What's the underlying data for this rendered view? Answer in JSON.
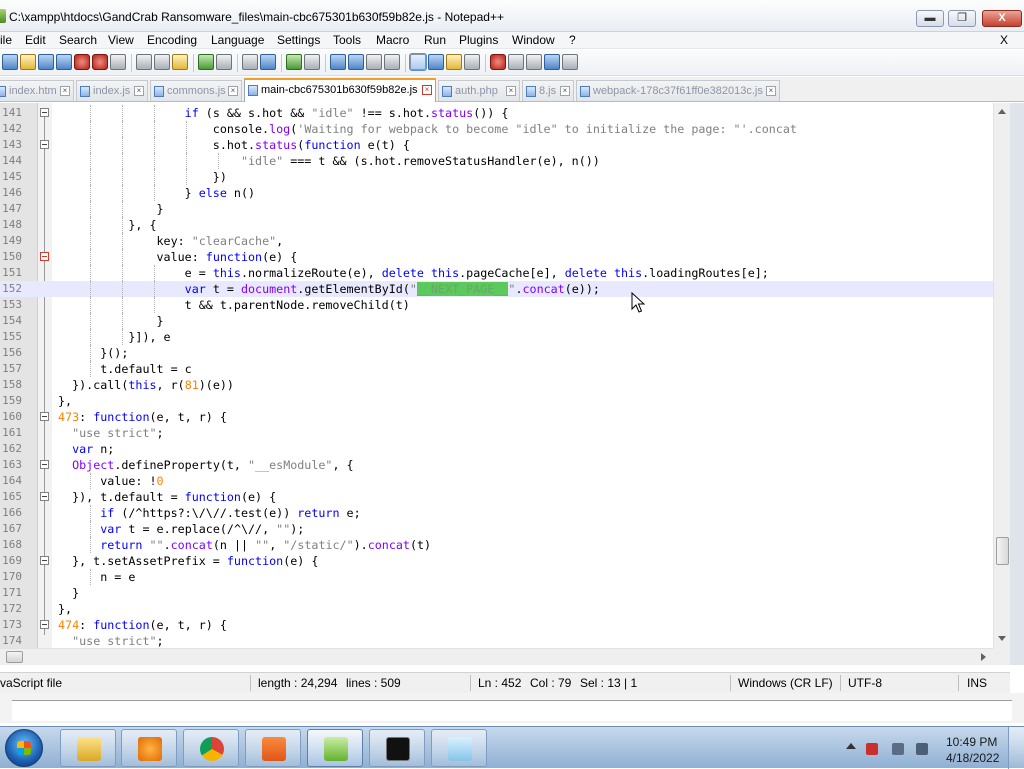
{
  "window": {
    "title": "C:\\xampp\\htdocs\\GandCrab Ransomware_files\\main-cbc675301b630f59b82e.js - Notepad++",
    "minimize_label": "▬",
    "maximize_label": "❐",
    "close_label": "X"
  },
  "menu": {
    "items": [
      "ile",
      "Edit",
      "Search",
      "View",
      "Encoding",
      "Language",
      "Settings",
      "Tools",
      "Macro",
      "Run",
      "Plugins",
      "Window",
      "?"
    ],
    "close_document": "X"
  },
  "tabs": [
    {
      "label": "index.htm",
      "active": false
    },
    {
      "label": "index.js",
      "active": false
    },
    {
      "label": "commons.js",
      "active": false
    },
    {
      "label": "main-cbc675301b630f59b82e.js",
      "active": true
    },
    {
      "label": "auth.php",
      "active": false
    },
    {
      "label": "8.js",
      "active": false
    },
    {
      "label": "webpack-178c37f61ff0e382013c.js",
      "active": false
    }
  ],
  "editor": {
    "lines": [
      {
        "num": "141",
        "text": "                  if (s && s.hot && \"idle\" !== s.hot.status()) {"
      },
      {
        "num": "142",
        "text": "                      console.log('Waiting for webpack to become \"idle\" to initialize the page: \"'.concat"
      },
      {
        "num": "143",
        "text": "                      s.hot.status(function e(t) {"
      },
      {
        "num": "144",
        "text": "                          \"idle\" === t && (s.hot.removeStatusHandler(e), n())"
      },
      {
        "num": "145",
        "text": "                      })"
      },
      {
        "num": "146",
        "text": "                  } else n()"
      },
      {
        "num": "147",
        "text": "              }"
      },
      {
        "num": "148",
        "text": "          }, {"
      },
      {
        "num": "149",
        "text": "              key: \"clearCache\","
      },
      {
        "num": "150",
        "text": "              value: function(e) {"
      },
      {
        "num": "151",
        "text": "                  e = this.normalizeRoute(e), delete this.pageCache[e], delete this.loadingRoutes[e];"
      },
      {
        "num": "152",
        "text": "                  var t = document.getElementById(\"__NEXT_PAGE__\".concat(e));"
      },
      {
        "num": "153",
        "text": "                  t && t.parentNode.removeChild(t)"
      },
      {
        "num": "154",
        "text": "              }"
      },
      {
        "num": "155",
        "text": "          }]), e"
      },
      {
        "num": "156",
        "text": "      }();"
      },
      {
        "num": "157",
        "text": "      t.default = c"
      },
      {
        "num": "158",
        "text": "  }).call(this, r(81)(e))"
      },
      {
        "num": "159",
        "text": "},"
      },
      {
        "num": "160",
        "text": "473: function(e, t, r) {"
      },
      {
        "num": "161",
        "text": "  \"use strict\";"
      },
      {
        "num": "162",
        "text": "  var n;"
      },
      {
        "num": "163",
        "text": "  Object.defineProperty(t, \"__esModule\", {"
      },
      {
        "num": "164",
        "text": "      value: !0"
      },
      {
        "num": "165",
        "text": "  }), t.default = function(e) {"
      },
      {
        "num": "166",
        "text": "      if (/^https?:\\/\\//.test(e)) return e;"
      },
      {
        "num": "167",
        "text": "      var t = e.replace(/^\\//, \"\");"
      },
      {
        "num": "168",
        "text": "      return \"\".concat(n || \"\", \"/static/\").concat(t)"
      },
      {
        "num": "169",
        "text": "  }, t.setAssetPrefix = function(e) {"
      },
      {
        "num": "170",
        "text": "      n = e"
      },
      {
        "num": "171",
        "text": "  }"
      },
      {
        "num": "172",
        "text": "},"
      },
      {
        "num": "173",
        "text": "474: function(e, t, r) {"
      },
      {
        "num": "174",
        "text": "  \"use strict\";"
      }
    ]
  },
  "status": {
    "file_type": "vaScript file",
    "length": "length : 24,294",
    "lines": "lines : 509",
    "ln": "Ln : 452",
    "col": "Col : 79",
    "sel": "Sel : 13 | 1",
    "eol": "Windows (CR LF)",
    "encoding": "UTF-8",
    "mode": "INS"
  },
  "taskbar": {
    "apps": [
      "file-explorer-icon",
      "media-player-icon",
      "chrome-icon",
      "xampp-icon",
      "notepadpp-icon",
      "cmd-icon",
      "notepad-icon"
    ],
    "time": "10:49 PM",
    "date": "4/18/2022"
  },
  "colors": {
    "keyword": "#0000ff",
    "function": "#8000ff",
    "string": "#808080",
    "number": "#ff8000",
    "current_line": "#e8e8ff",
    "selection_highlight": "#5bc95b",
    "active_tab_accent": "#f0a02a"
  }
}
